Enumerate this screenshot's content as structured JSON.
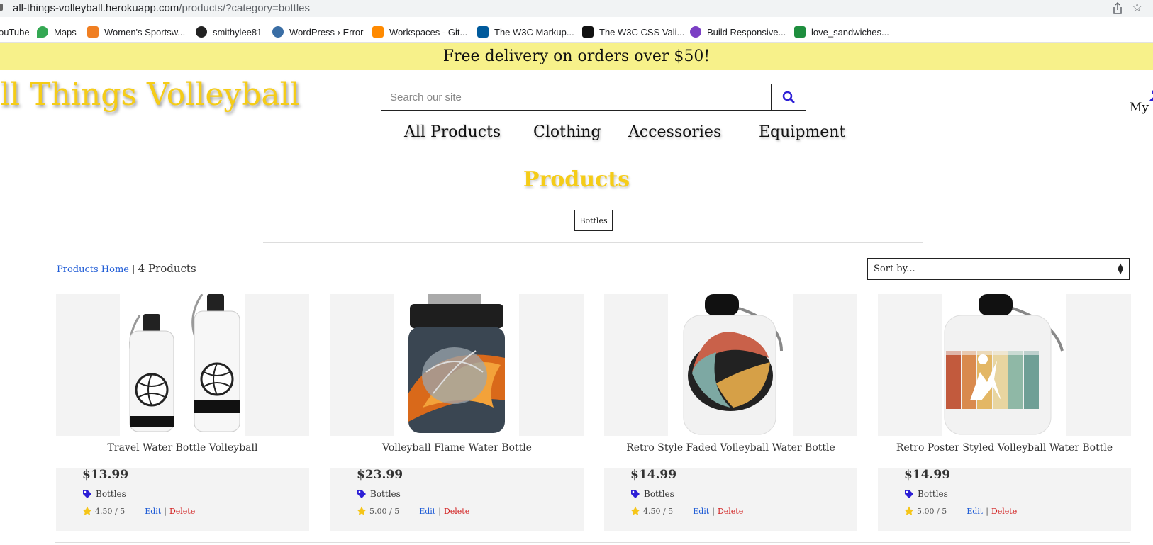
{
  "browser": {
    "url_host": "all-things-volleyball.herokuapp.com",
    "url_path": "/products/?category=bottles",
    "bookmarks": [
      {
        "label": "ouTube",
        "icon": "youtube-icon",
        "color": "#ff0000"
      },
      {
        "label": "Maps",
        "icon": "maps-icon",
        "color": "#34a853"
      },
      {
        "label": "Women's Sportsw...",
        "icon": "shop-icon",
        "color": "#f07f22"
      },
      {
        "label": "smithylee81",
        "icon": "github-icon",
        "color": "#222222"
      },
      {
        "label": "WordPress › Error",
        "icon": "wordpress-icon",
        "color": "#3a6ea5"
      },
      {
        "label": "Workspaces - Git...",
        "icon": "gitpod-icon",
        "color": "#ff8a00"
      },
      {
        "label": "The W3C Markup...",
        "icon": "w3c-icon",
        "color": "#005a9c"
      },
      {
        "label": "The W3C CSS Vali...",
        "icon": "css-validator-icon",
        "color": "#111111"
      },
      {
        "label": "Build Responsive...",
        "icon": "course-icon",
        "color": "#7b3fc4"
      },
      {
        "label": "love_sandwiches...",
        "icon": "sheets-icon",
        "color": "#1e8e3e"
      }
    ]
  },
  "promo": {
    "text": "Free delivery on orders over $50!"
  },
  "header": {
    "logo": "ll Things Volleyball",
    "search_placeholder": "Search our site",
    "account_label": "My A"
  },
  "nav": {
    "items": [
      "All Products",
      "Clothing",
      "Accessories",
      "Equipment"
    ]
  },
  "main": {
    "title": "Products",
    "category_chip": "Bottles",
    "breadcrumb_home": "Products Home",
    "breadcrumb_sep": "|",
    "product_count": "4 Products",
    "sort_label": "Sort by...",
    "edit_label": "Edit",
    "delete_label": "Delete",
    "link_sep": "|"
  },
  "products": [
    {
      "name": "Travel Water Bottle Volleyball",
      "price": "$13.99",
      "category": "Bottles",
      "rating": "4.50 / 5"
    },
    {
      "name": "Volleyball Flame Water Bottle",
      "price": "$23.99",
      "category": "Bottles",
      "rating": "5.00 / 5"
    },
    {
      "name": "Retro Style Faded Volleyball Water Bottle",
      "price": "$14.99",
      "category": "Bottles",
      "rating": "4.50 / 5"
    },
    {
      "name": "Retro Poster Styled Volleyball Water Bottle",
      "price": "$14.99",
      "category": "Bottles",
      "rating": "5.00 / 5"
    }
  ],
  "colors": {
    "accent_yellow": "#f5cc17",
    "promo_bg": "#f7f18a",
    "link_blue": "#1e5bd6",
    "delete_red": "#d21f1f",
    "icon_blue": "#2d1fd6"
  }
}
